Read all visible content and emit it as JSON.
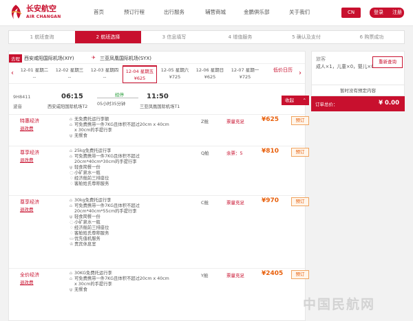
{
  "header": {
    "brand_cn": "长安航空",
    "brand_en": "AIR CHANGAN",
    "nav": [
      "首页",
      "预订行程",
      "出行服务",
      "辅营商城",
      "金鹏俱乐部",
      "关于我们"
    ],
    "lang": "CN",
    "login": "登录",
    "register": "注册",
    "accent": "#c8102e"
  },
  "steps": [
    "1 航班查询",
    "2 航班选择",
    "3 信息填写",
    "4 增值服务",
    "5 确认及支付",
    "6 购票成功"
  ],
  "route": {
    "tag": "去程",
    "from": "西安咸阳国际机场(XIY)",
    "to": "三亚凤凰国际机场(SYX)"
  },
  "dates": [
    {
      "d": "12-01 星期二",
      "p": "--"
    },
    {
      "d": "12-02 星期三",
      "p": "--"
    },
    {
      "d": "12-03 星期四",
      "p": "--"
    },
    {
      "d": "12-04 星期五",
      "p": "¥625"
    },
    {
      "d": "12-05 星期六",
      "p": "¥725"
    },
    {
      "d": "12-06 星期日",
      "p": "¥625"
    },
    {
      "d": "12-07 星期一",
      "p": "¥725"
    }
  ],
  "price_cal": "低价日历",
  "flight": {
    "no": "9H8411",
    "aircraft": "波音",
    "dep_time": "06:15",
    "dep_ap": "西安咸阳国际机场T2",
    "stop": "经停",
    "duration": "05小时35分钟",
    "arr_time": "11:50",
    "arr_ap": "三亚凤凰国际机场T1",
    "collapse": "收起"
  },
  "cabins": [
    {
      "name": "特惠经济",
      "rule": "退改费",
      "cls": "Z舱",
      "seat": "票量充足",
      "price": "¥625",
      "book": "预订",
      "perks": [
        "无免费托运行李额",
        "可免费携带一件7KG且体积不超过20cm x 40cm",
        "x 30cm的手提行李",
        "无餐食"
      ]
    },
    {
      "name": "尊享经济",
      "rule": "退改费",
      "cls": "Q舱",
      "seat": "余票：5",
      "price": "¥810",
      "book": "预订",
      "perks": [
        "25kg免费托运行李",
        "可免费携带一件7KG且体积不超过",
        "20cm*40cm*30cm的手提行李",
        "轻食简餐一份",
        "小矿泉水一瓶",
        "经济舱前三排座位",
        "客舱姓氏尊称服务"
      ]
    },
    {
      "name": "尊享经济",
      "rule": "退改费",
      "cls": "C舱",
      "seat": "票量充足",
      "price": "¥970",
      "book": "预订",
      "perks": [
        "30kg免费托运行李",
        "可免费携带一件7KG且体积不超过",
        "20cm*40cm*55cm的手提行李",
        "轻食简餐一份",
        "小矿泉水一瓶",
        "经济舱前三排座位",
        "客舱姓氏尊称服务",
        "优先值机服务",
        "贵宾休息室"
      ]
    },
    {
      "name": "全价经济",
      "rule": "退改费",
      "cls": "Y舱",
      "seat": "票量充足",
      "price": "¥2405",
      "book": "预订",
      "perks": [
        "30KG免费托运行李",
        "可免费携带一件7KG且体积不超过20cm x 40cm",
        "x 30cm的手提行李",
        "无餐食"
      ]
    }
  ],
  "side": {
    "title": "旅客",
    "pax": "成人×1，儿童×0，婴儿×0",
    "reset": "重新查询",
    "none": "暂时没有预定内容",
    "total_label": "订单总价：",
    "total": "¥ 0.00"
  },
  "watermark": "中国民航网"
}
